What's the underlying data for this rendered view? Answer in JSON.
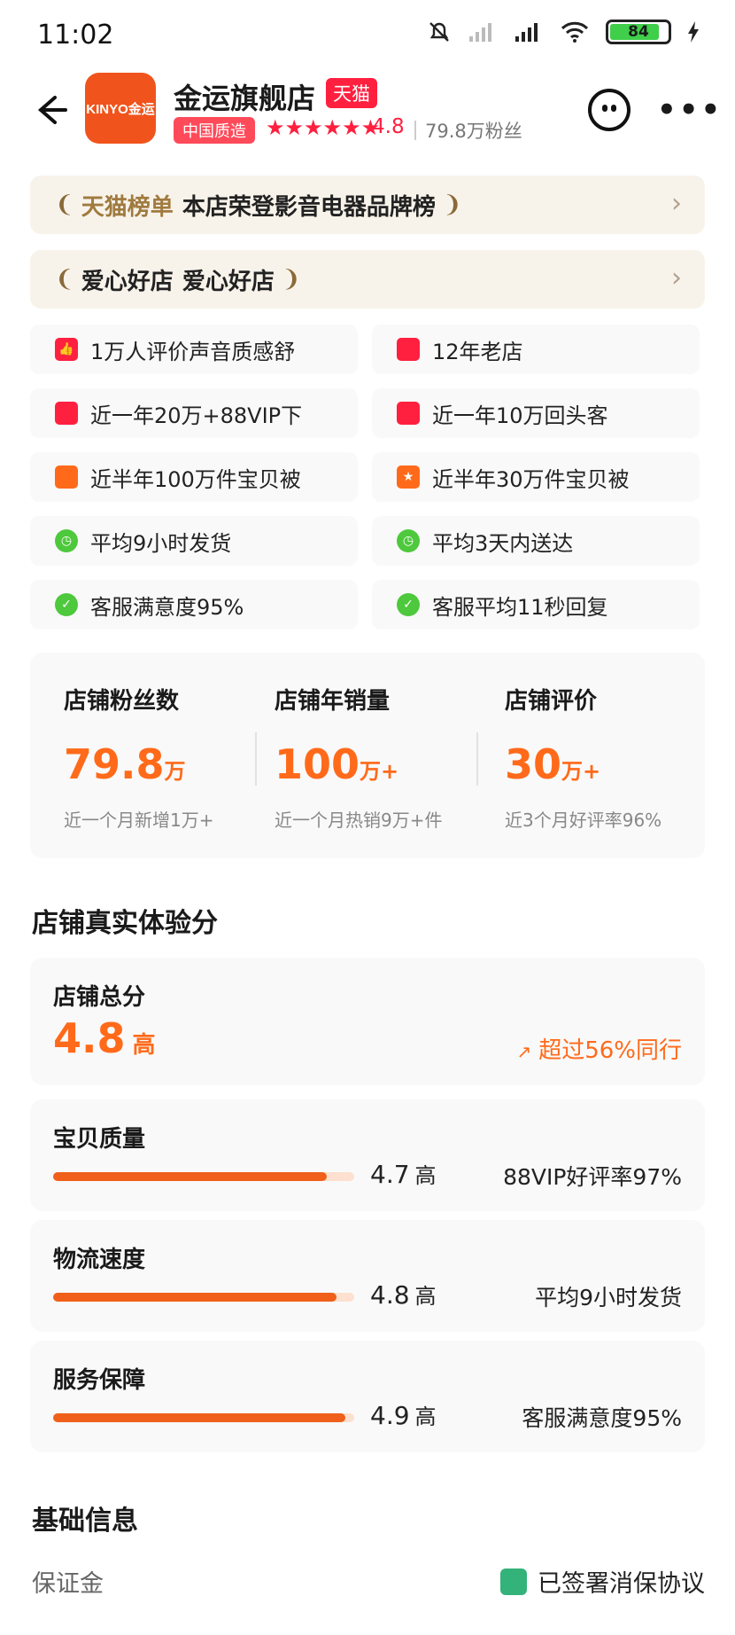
{
  "status_bar": {
    "time": "11:02",
    "battery": "84"
  },
  "header": {
    "logo_text": "KINYO金运",
    "shop_name": "金运旗舰店",
    "tmall_tag": "天猫",
    "quality_tag": "中国质造",
    "stars": "★★★★★★",
    "rating": "4.8",
    "fans": "79.8万粉丝"
  },
  "banners": [
    {
      "prefix": "天猫榜单",
      "text": "本店荣登影音电器品牌榜"
    },
    {
      "prefix": "爱心好店",
      "text": "爱心好店"
    }
  ],
  "features": [
    {
      "icon": "thumb-up-icon",
      "color": "red",
      "text": "1万人评价声音质感舒"
    },
    {
      "icon": "store-icon",
      "color": "red",
      "text": "12年老店"
    },
    {
      "icon": "shopping-bag-icon",
      "color": "red",
      "text": "近一年20万+88VIP下"
    },
    {
      "icon": "returning-user-icon",
      "color": "red",
      "text": "近一年10万回头客"
    },
    {
      "icon": "cart-icon",
      "color": "orange",
      "text": "近半年100万件宝贝被"
    },
    {
      "icon": "star-badge-icon",
      "color": "orange",
      "text": "近半年30万件宝贝被"
    },
    {
      "icon": "clock-icon",
      "color": "green",
      "text": "平均9小时发货"
    },
    {
      "icon": "clock-icon",
      "color": "green",
      "text": "平均3天内送达"
    },
    {
      "icon": "shield-check-icon",
      "color": "green",
      "text": "客服满意度95%"
    },
    {
      "icon": "shield-check-icon",
      "color": "green",
      "text": "客服平均11秒回复"
    }
  ],
  "stats": [
    {
      "label": "店铺粉丝数",
      "value": "79.8",
      "unit": "万",
      "sub": "近一个月新增1万+"
    },
    {
      "label": "店铺年销量",
      "value": "100",
      "unit": "万+",
      "sub": "近一个月热销9万+件"
    },
    {
      "label": "店铺评价",
      "value": "30",
      "unit": "万+",
      "sub": "近3个月好评率96%"
    }
  ],
  "experience": {
    "title": "店铺真实体验分",
    "total_label": "店铺总分",
    "total_score": "4.8",
    "total_level": "高",
    "beat": "超过56%同行",
    "metrics": [
      {
        "label": "宝贝质量",
        "score": "4.7",
        "level": "高",
        "note": "88VIP好评率97%",
        "bar_fraction": 0.91
      },
      {
        "label": "物流速度",
        "score": "4.8",
        "level": "高",
        "note": "平均9小时发货",
        "bar_fraction": 0.94
      },
      {
        "label": "服务保障",
        "score": "4.9",
        "level": "高",
        "note": "客服满意度95%",
        "bar_fraction": 0.97
      }
    ]
  },
  "basic_info": {
    "title": "基础信息",
    "deposit_label": "保证金",
    "deposit_value": "已签署消保协议"
  },
  "colors": {
    "accent": "#ff6a1a",
    "tmall_red": "#ff2040",
    "bar_track": "#fde0cf"
  }
}
